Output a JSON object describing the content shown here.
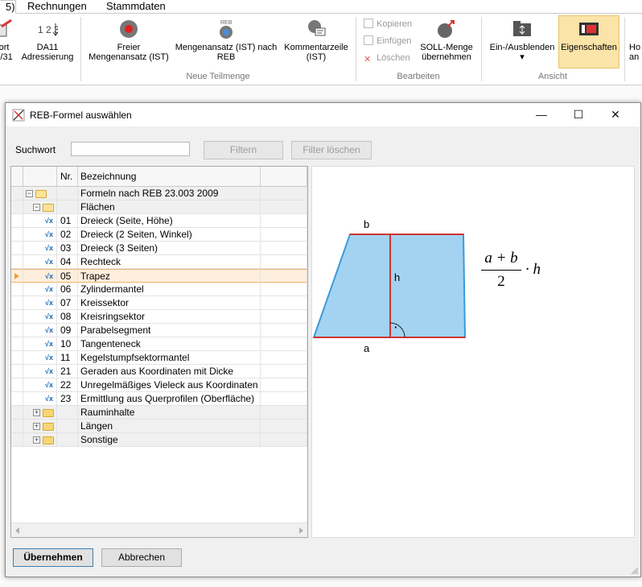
{
  "app": {
    "tabs": [
      "5)",
      "Rechnungen",
      "Stammdaten"
    ],
    "ribbon": {
      "buttons": [
        {
          "line1": "ort",
          "line2": "1/31"
        },
        {
          "line1": "DA11",
          "line2": "Adressierung"
        },
        {
          "line1": "Freier",
          "line2": "Mengenansatz (IST)"
        },
        {
          "line1": "Mengenansatz (IST) nach",
          "line2": "REB"
        },
        {
          "line1": "Kommentarzeile",
          "line2": "(IST)"
        },
        {
          "line1": "SOLL-Menge",
          "line2": "übernehmen"
        },
        {
          "line1": "Ein-/Ausblenden",
          "line2": "▾"
        },
        {
          "line1": "Eigenschaften",
          "line2": ""
        },
        {
          "line1": "Ho",
          "line2": "an"
        }
      ],
      "small_buttons": [
        "Kopieren",
        "Einfügen",
        "Löschen"
      ],
      "icon_labels": {
        "sort": "1 2 3",
        "reb": "REB"
      },
      "groups": [
        "Neue Teilmenge",
        "Bearbeiten",
        "Ansicht"
      ]
    }
  },
  "dialog": {
    "title": "REB-Formel auswählen",
    "controls": {
      "minimize": "—",
      "maximize": "☐",
      "close": "✕"
    },
    "search": {
      "label": "Suchwort",
      "value": "",
      "filter_button": "Filtern",
      "clear_button": "Filter löschen"
    },
    "grid": {
      "columns": [
        "Nr.",
        "Bezeichnung"
      ],
      "rows": [
        {
          "level": 0,
          "kind": "group",
          "expanded": true,
          "nr": "",
          "label": "Formeln nach REB 23.003 2009"
        },
        {
          "level": 1,
          "kind": "group",
          "expanded": true,
          "nr": "",
          "label": "Flächen"
        },
        {
          "level": 2,
          "kind": "item",
          "nr": "01",
          "label": "Dreieck (Seite, Höhe)"
        },
        {
          "level": 2,
          "kind": "item",
          "nr": "02",
          "label": "Dreieck (2 Seiten, Winkel)"
        },
        {
          "level": 2,
          "kind": "item",
          "nr": "03",
          "label": "Dreieck (3 Seiten)"
        },
        {
          "level": 2,
          "kind": "item",
          "nr": "04",
          "label": "Rechteck"
        },
        {
          "level": 2,
          "kind": "item",
          "nr": "05",
          "label": "Trapez",
          "selected": true
        },
        {
          "level": 2,
          "kind": "item",
          "nr": "06",
          "label": "Zylindermantel"
        },
        {
          "level": 2,
          "kind": "item",
          "nr": "07",
          "label": "Kreissektor"
        },
        {
          "level": 2,
          "kind": "item",
          "nr": "08",
          "label": "Kreisringsektor"
        },
        {
          "level": 2,
          "kind": "item",
          "nr": "09",
          "label": "Parabelsegment"
        },
        {
          "level": 2,
          "kind": "item",
          "nr": "10",
          "label": "Tangenteneck"
        },
        {
          "level": 2,
          "kind": "item",
          "nr": "11",
          "label": "Kegelstumpfsektormantel"
        },
        {
          "level": 2,
          "kind": "item",
          "nr": "21",
          "label": "Geraden aus Koordinaten mit Dicke"
        },
        {
          "level": 2,
          "kind": "item",
          "nr": "22",
          "label": "Unregelmäßiges Vieleck aus Koordinaten"
        },
        {
          "level": 2,
          "kind": "item",
          "nr": "23",
          "label": "Ermittlung aus Querprofilen (Oberfläche)"
        },
        {
          "level": 1,
          "kind": "group",
          "expanded": false,
          "nr": "",
          "label": "Rauminhalte"
        },
        {
          "level": 1,
          "kind": "group",
          "expanded": false,
          "nr": "",
          "label": "Längen"
        },
        {
          "level": 1,
          "kind": "group",
          "expanded": false,
          "nr": "",
          "label": "Sonstige"
        }
      ]
    },
    "preview": {
      "labels": {
        "top": "b",
        "bottom": "a",
        "height": "h",
        "right_angle": "·"
      },
      "formula": {
        "numerator": "a + b",
        "denominator": "2",
        "factor": "· h"
      },
      "colors": {
        "fill": "#a3d3f0",
        "outline": "#3a9ad9",
        "bases": "#cc3333",
        "height_line": "#cc3333"
      }
    },
    "buttons": {
      "ok": "Übernehmen",
      "cancel": "Abbrechen"
    }
  }
}
